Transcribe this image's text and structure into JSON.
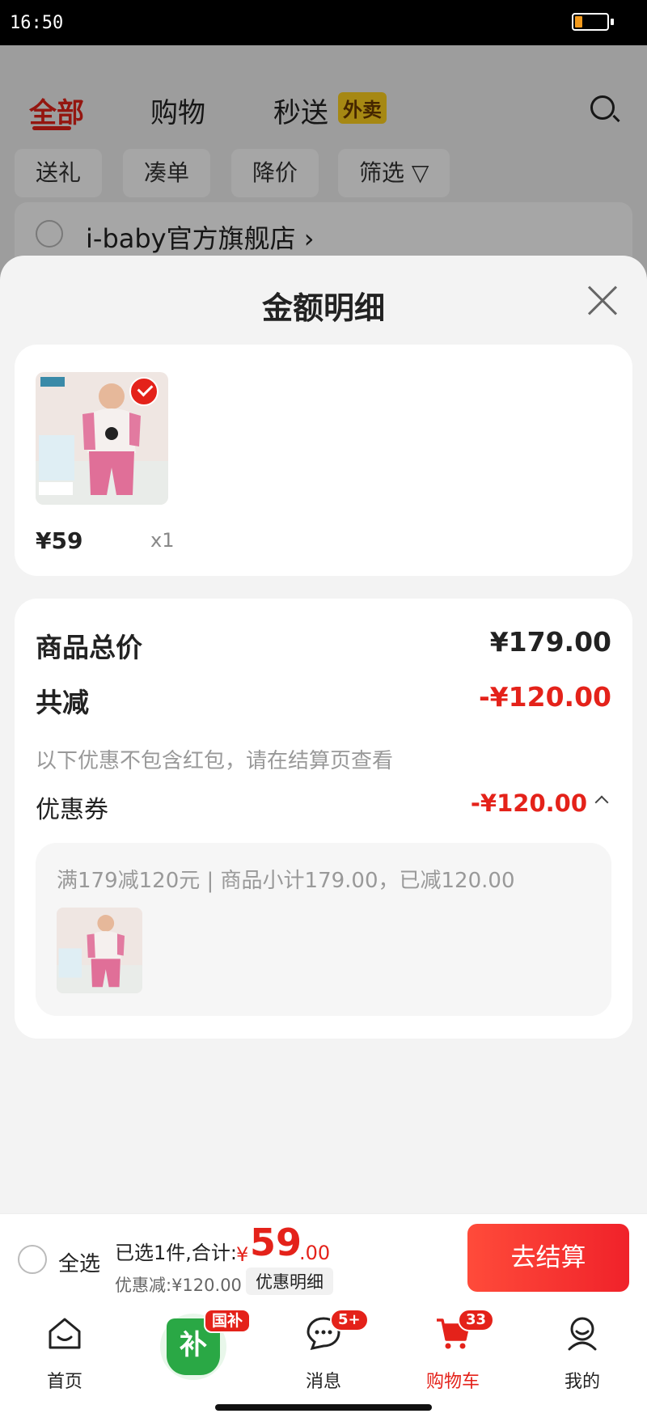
{
  "status_bar": {
    "time": "16:50",
    "battery_level": 0.2
  },
  "background": {
    "tabs": [
      {
        "label": "全部",
        "active": true
      },
      {
        "label": "购物",
        "active": false
      },
      {
        "label": "秒送",
        "active": false,
        "badge": "外卖"
      }
    ],
    "chips": [
      "送礼",
      "凑单",
      "降价",
      "筛选"
    ],
    "store_name": "i-baby官方旗舰店 ›"
  },
  "sheet": {
    "title": "金额明细",
    "product": {
      "price": "¥59",
      "quantity": "x1"
    },
    "summary": {
      "total_label": "商品总价",
      "total_value": "¥179.00",
      "reduce_label": "共减",
      "reduce_value": "-¥120.00",
      "note": "以下优惠不包含红包，请在结算页查看",
      "coupon_label": "优惠券",
      "coupon_value": "-¥120.00",
      "coupon_desc": "满179减120元 | 商品小计179.00，已减120.00"
    }
  },
  "bottom_bar": {
    "select_all": "全选",
    "selected_info": "已选1件,合计:",
    "total_currency": "¥",
    "total_int": "59",
    "total_dec": ".00",
    "discount_info": "优惠减:¥120.00",
    "detail_button": "优惠明细",
    "checkout_button": "去结算"
  },
  "tab_bar": {
    "tabs": [
      {
        "label": "首页",
        "icon": "home-icon"
      },
      {
        "label": "",
        "icon": "guobu-icon",
        "badge": "国补",
        "icon_text": "补"
      },
      {
        "label": "消息",
        "icon": "message-icon",
        "badge": "5+"
      },
      {
        "label": "购物车",
        "icon": "cart-icon",
        "badge": "33",
        "active": true
      },
      {
        "label": "我的",
        "icon": "profile-icon"
      }
    ]
  },
  "colors": {
    "accent": "#e4221a",
    "sheet_bg": "#f3f3f3",
    "card_bg": "#ffffff"
  }
}
